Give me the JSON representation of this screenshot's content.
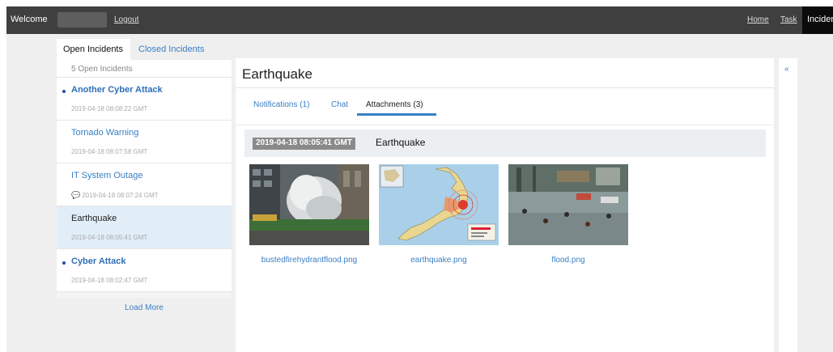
{
  "topbar": {
    "welcome": "Welcome",
    "logout": "Logout",
    "home": "Home",
    "task": "Task",
    "incidents": "Incidents"
  },
  "tabs": {
    "open": "Open Incidents",
    "closed": "Closed Incidents"
  },
  "list": {
    "header": "5 Open Incidents",
    "items": [
      {
        "title": "Another Cyber Attack",
        "time": "2019-04-18 08:08:22 GMT",
        "unread": true,
        "selected": false,
        "chat": false
      },
      {
        "title": "Tornado Warning",
        "time": "2019-04-18 08:07:58 GMT",
        "unread": false,
        "selected": false,
        "chat": false
      },
      {
        "title": "IT System Outage",
        "time": "2019-04-18 08:07:24 GMT",
        "unread": false,
        "selected": false,
        "chat": true
      },
      {
        "title": "Earthquake",
        "time": "2019-04-18 08:05:41 GMT",
        "unread": false,
        "selected": true,
        "chat": false
      },
      {
        "title": "Cyber Attack",
        "time": "2019-04-18 08:02:47 GMT",
        "unread": true,
        "selected": false,
        "chat": false
      }
    ],
    "load_more": "Load More"
  },
  "main": {
    "title": "Earthquake",
    "subtabs": {
      "notifications": "Notifications (1)",
      "chat": "Chat",
      "attachments": "Attachments (3)"
    },
    "attachment_header": {
      "timestamp": "2019-04-18 08:05:41 GMT",
      "title": "Earthquake"
    },
    "attachments": [
      {
        "filename": "bustedfirehydrantflood.png"
      },
      {
        "filename": "earthquake.png"
      },
      {
        "filename": "flood.png"
      }
    ]
  },
  "right_panel": {
    "collapse": "«"
  },
  "colors": {
    "topbar": "#3f3f3f",
    "link": "#3a7fc4",
    "selected_row": "#e1eef8",
    "unread_dot": "#1d4ea2"
  }
}
